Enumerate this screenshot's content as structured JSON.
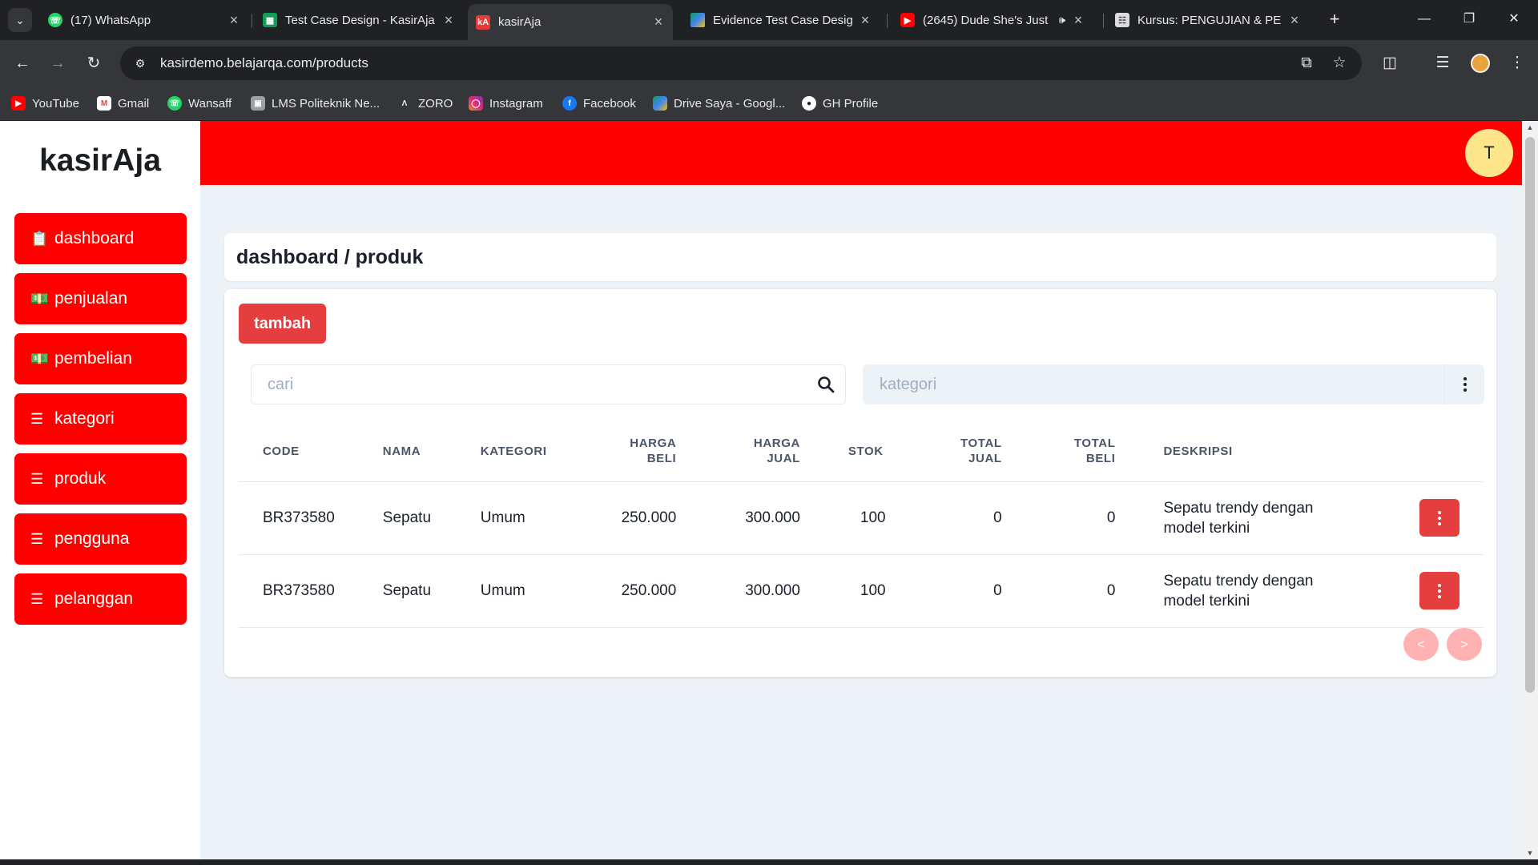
{
  "browser": {
    "tabs": [
      {
        "title": "(17) WhatsApp",
        "icon": "whatsapp-icon",
        "color": "#25d366"
      },
      {
        "title": "Test Case Design - KasirAja",
        "icon": "sheets-icon",
        "color": "#0f9d58"
      },
      {
        "title": "kasirAja",
        "icon": "kasiraja-icon",
        "color": "#e53935",
        "glyph": "kA"
      },
      {
        "title": "Evidence Test Case Design",
        "icon": "drive-icon",
        "color": "#fbbc04"
      },
      {
        "title": "(2645) Dude She's Just",
        "icon": "youtube-icon",
        "color": "#ff0000"
      },
      {
        "title": "Kursus: PENGUJIAN & PEN",
        "icon": "moodle-icon",
        "color": "#f98012"
      }
    ],
    "url": "kasirdemo.belajarqa.com/products",
    "bookmarks": [
      {
        "label": "YouTube",
        "icon": "youtube-icon",
        "color": "#ff0000"
      },
      {
        "label": "Gmail",
        "icon": "gmail-icon",
        "color": "#ea4335"
      },
      {
        "label": "Wansaff",
        "icon": "whatsapp-icon",
        "color": "#25d366"
      },
      {
        "label": "LMS Politeknik Ne...",
        "icon": "lms-icon",
        "color": "#9aa0a6"
      },
      {
        "label": "ZORO",
        "icon": "zoro-icon",
        "color": "#35363a"
      },
      {
        "label": "Instagram",
        "icon": "instagram-icon",
        "color": "#c13584"
      },
      {
        "label": "Facebook",
        "icon": "facebook-icon",
        "color": "#1877f2"
      },
      {
        "label": "Drive Saya - Googl...",
        "icon": "drive-icon",
        "color": "#fbbc04"
      },
      {
        "label": "GH Profile",
        "icon": "github-icon",
        "color": "#ffffff"
      }
    ]
  },
  "app": {
    "logo": "kasirAja",
    "avatar_initial": "T",
    "accent": "#ff0000",
    "button_red": "#e53e3e",
    "nav": [
      {
        "label": "dashboard",
        "icon": "clipboard-icon"
      },
      {
        "label": "penjualan",
        "icon": "money-icon"
      },
      {
        "label": "pembelian",
        "icon": "money-icon"
      },
      {
        "label": "kategori",
        "icon": "list-icon"
      },
      {
        "label": "produk",
        "icon": "list-icon"
      },
      {
        "label": "pengguna",
        "icon": "list-icon"
      },
      {
        "label": "pelanggan",
        "icon": "list-icon"
      }
    ],
    "breadcrumb": "dashboard / produk",
    "add_button": "tambah",
    "search_placeholder": "cari",
    "category_placeholder": "kategori",
    "table": {
      "headers": [
        "CODE",
        "NAMA",
        "KATEGORI",
        "HARGA BELI",
        "HARGA JUAL",
        "STOK",
        "TOTAL JUAL",
        "TOTAL BELI",
        "DESKRIPSI"
      ],
      "rows": [
        [
          "BR373580",
          "Sepatu",
          "Umum",
          "250.000",
          "300.000",
          "100",
          "0",
          "0",
          "Sepatu trendy dengan model terkini"
        ],
        [
          "BR373580",
          "Sepatu",
          "Umum",
          "250.000",
          "300.000",
          "100",
          "0",
          "0",
          "Sepatu trendy dengan model terkini"
        ]
      ]
    },
    "pager": {
      "prev": "<",
      "next": ">"
    }
  }
}
